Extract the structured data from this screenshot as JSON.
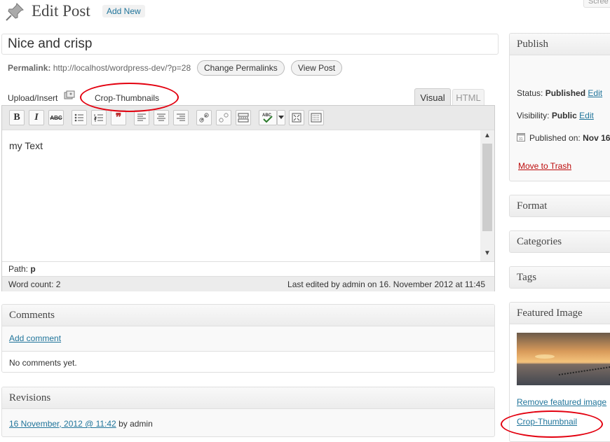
{
  "header": {
    "title": "Edit Post",
    "add_new": "Add New",
    "screen_options": "Scree"
  },
  "post": {
    "title": "Nice and crisp",
    "permalink_label": "Permalink:",
    "permalink_url": "http://localhost/wordpress-dev/?p=28",
    "change_permalinks": "Change Permalinks",
    "view_post": "View Post"
  },
  "editor": {
    "upload_insert": "Upload/Insert",
    "crop_tab": "Crop-Thumbnails",
    "tab_visual": "Visual",
    "tab_html": "HTML",
    "content": "my Text",
    "path_label": "Path:",
    "path_value": "p",
    "word_count": "Word count: 2",
    "last_edited": "Last edited by admin on 16. November 2012 at 11:45",
    "toolbar": {
      "bold": "B",
      "italic": "I",
      "strike": "ABC"
    }
  },
  "comments": {
    "heading": "Comments",
    "add_comment": "Add comment",
    "none": "No comments yet."
  },
  "revisions": {
    "heading": "Revisions",
    "link": "16 November, 2012 @ 11:42",
    "by": "by admin"
  },
  "publish": {
    "heading": "Publish",
    "status_label": "Status:",
    "status_value": "Published",
    "visibility_label": "Visibility:",
    "visibility_value": "Public",
    "edit": "Edit",
    "published_on_label": "Published on:",
    "published_on_value": "Nov 16",
    "move_to_trash": "Move to Trash"
  },
  "sidebar": {
    "format": "Format",
    "categories": "Categories",
    "tags": "Tags",
    "featured_image": "Featured Image",
    "remove_featured": "Remove featured image",
    "crop_thumbnail": "Crop-Thumbnail"
  },
  "colors": {
    "link": "#21759b",
    "trash": "#bc0b0b",
    "annotation": "#e3000f"
  }
}
